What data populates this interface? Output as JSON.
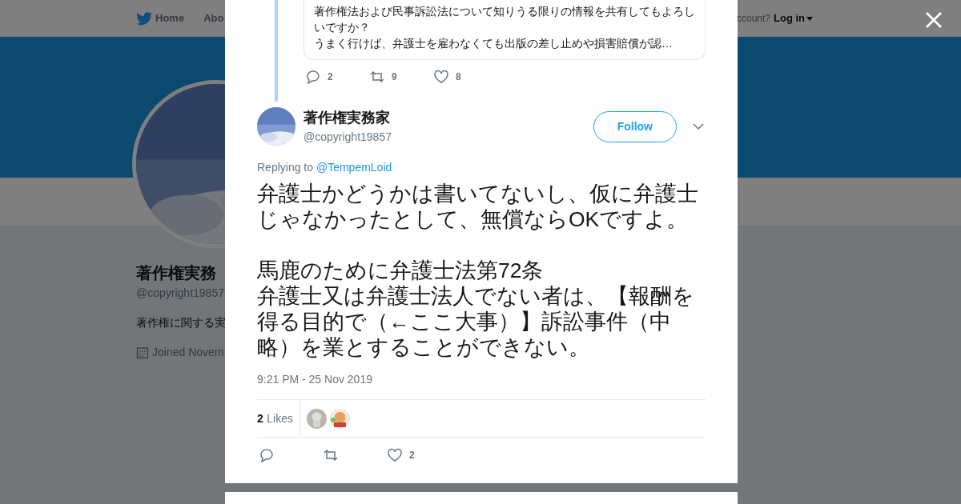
{
  "background_page": {
    "nav": [
      {
        "label": "Home",
        "kind": "home"
      },
      {
        "label": "Abo",
        "kind": "plain"
      }
    ],
    "account_prompt": "ccount?",
    "login": "Log in",
    "profile_name": "著作権実務",
    "handle": "@copyright19857",
    "bio": "著作権に関する実",
    "joined": "Joined Novem"
  },
  "modal": {
    "parent_tweet": {
      "lines": [
        "著作権法および民事訴訟法について知りうる限りの情報を共有してもよろし",
        "いですか？",
        "うまく行けば、弁護士を雇わなくても出版の差し止めや損害賠償が認…"
      ],
      "actions": [
        {
          "kind": "reply",
          "count": "2"
        },
        {
          "kind": "retweet",
          "count": "9"
        },
        {
          "kind": "like",
          "count": "8"
        }
      ]
    },
    "tweet": {
      "name": "著作権実務家",
      "handle": "@copyright19857",
      "follow": "Follow",
      "replying_prefix": "Replying to",
      "replying_to": "@TempemLoid",
      "text_blocks": [
        [
          "弁護士かどうかは書いてないし、仮に弁護士じゃなかったとして、無償ならOKですよ。"
        ],
        [
          "馬鹿のために弁護士法第72条",
          "弁護士又は弁護士法人でない者は、【報酬を得る目的で（←ここ大事）】訴訟事件（中略）を業とすることができない。"
        ]
      ],
      "timestamp": "9:21 PM - 25 Nov 2019",
      "likes_count": "2",
      "likes_label": "Likes",
      "likers": [
        {
          "kind": "picture"
        },
        {
          "kind": "picture"
        }
      ],
      "actions": [
        {
          "kind": "reply"
        },
        {
          "kind": "retweet"
        },
        {
          "kind": "like",
          "count": "2"
        }
      ]
    }
  }
}
